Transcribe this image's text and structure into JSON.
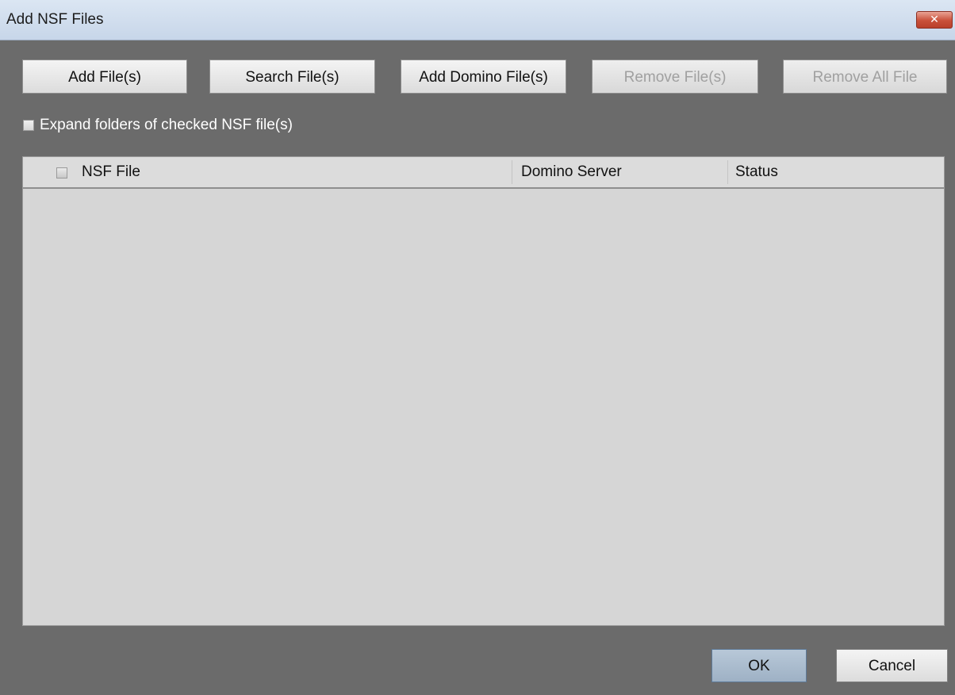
{
  "window": {
    "title": "Add NSF Files",
    "close_icon": "close-icon",
    "close_glyph": "✕"
  },
  "toolbar": {
    "add_files": "Add File(s)",
    "search_files": "Search File(s)",
    "add_domino_files": "Add Domino File(s)",
    "remove_files": "Remove File(s)",
    "remove_all_file": "Remove All File"
  },
  "options": {
    "expand_folders_label": "Expand folders of checked NSF file(s)",
    "expand_folders_checked": false
  },
  "file_list": {
    "columns": [
      "NSF File",
      "Domino Server",
      "Status"
    ],
    "rows": []
  },
  "footer": {
    "ok": "OK",
    "cancel": "Cancel"
  }
}
